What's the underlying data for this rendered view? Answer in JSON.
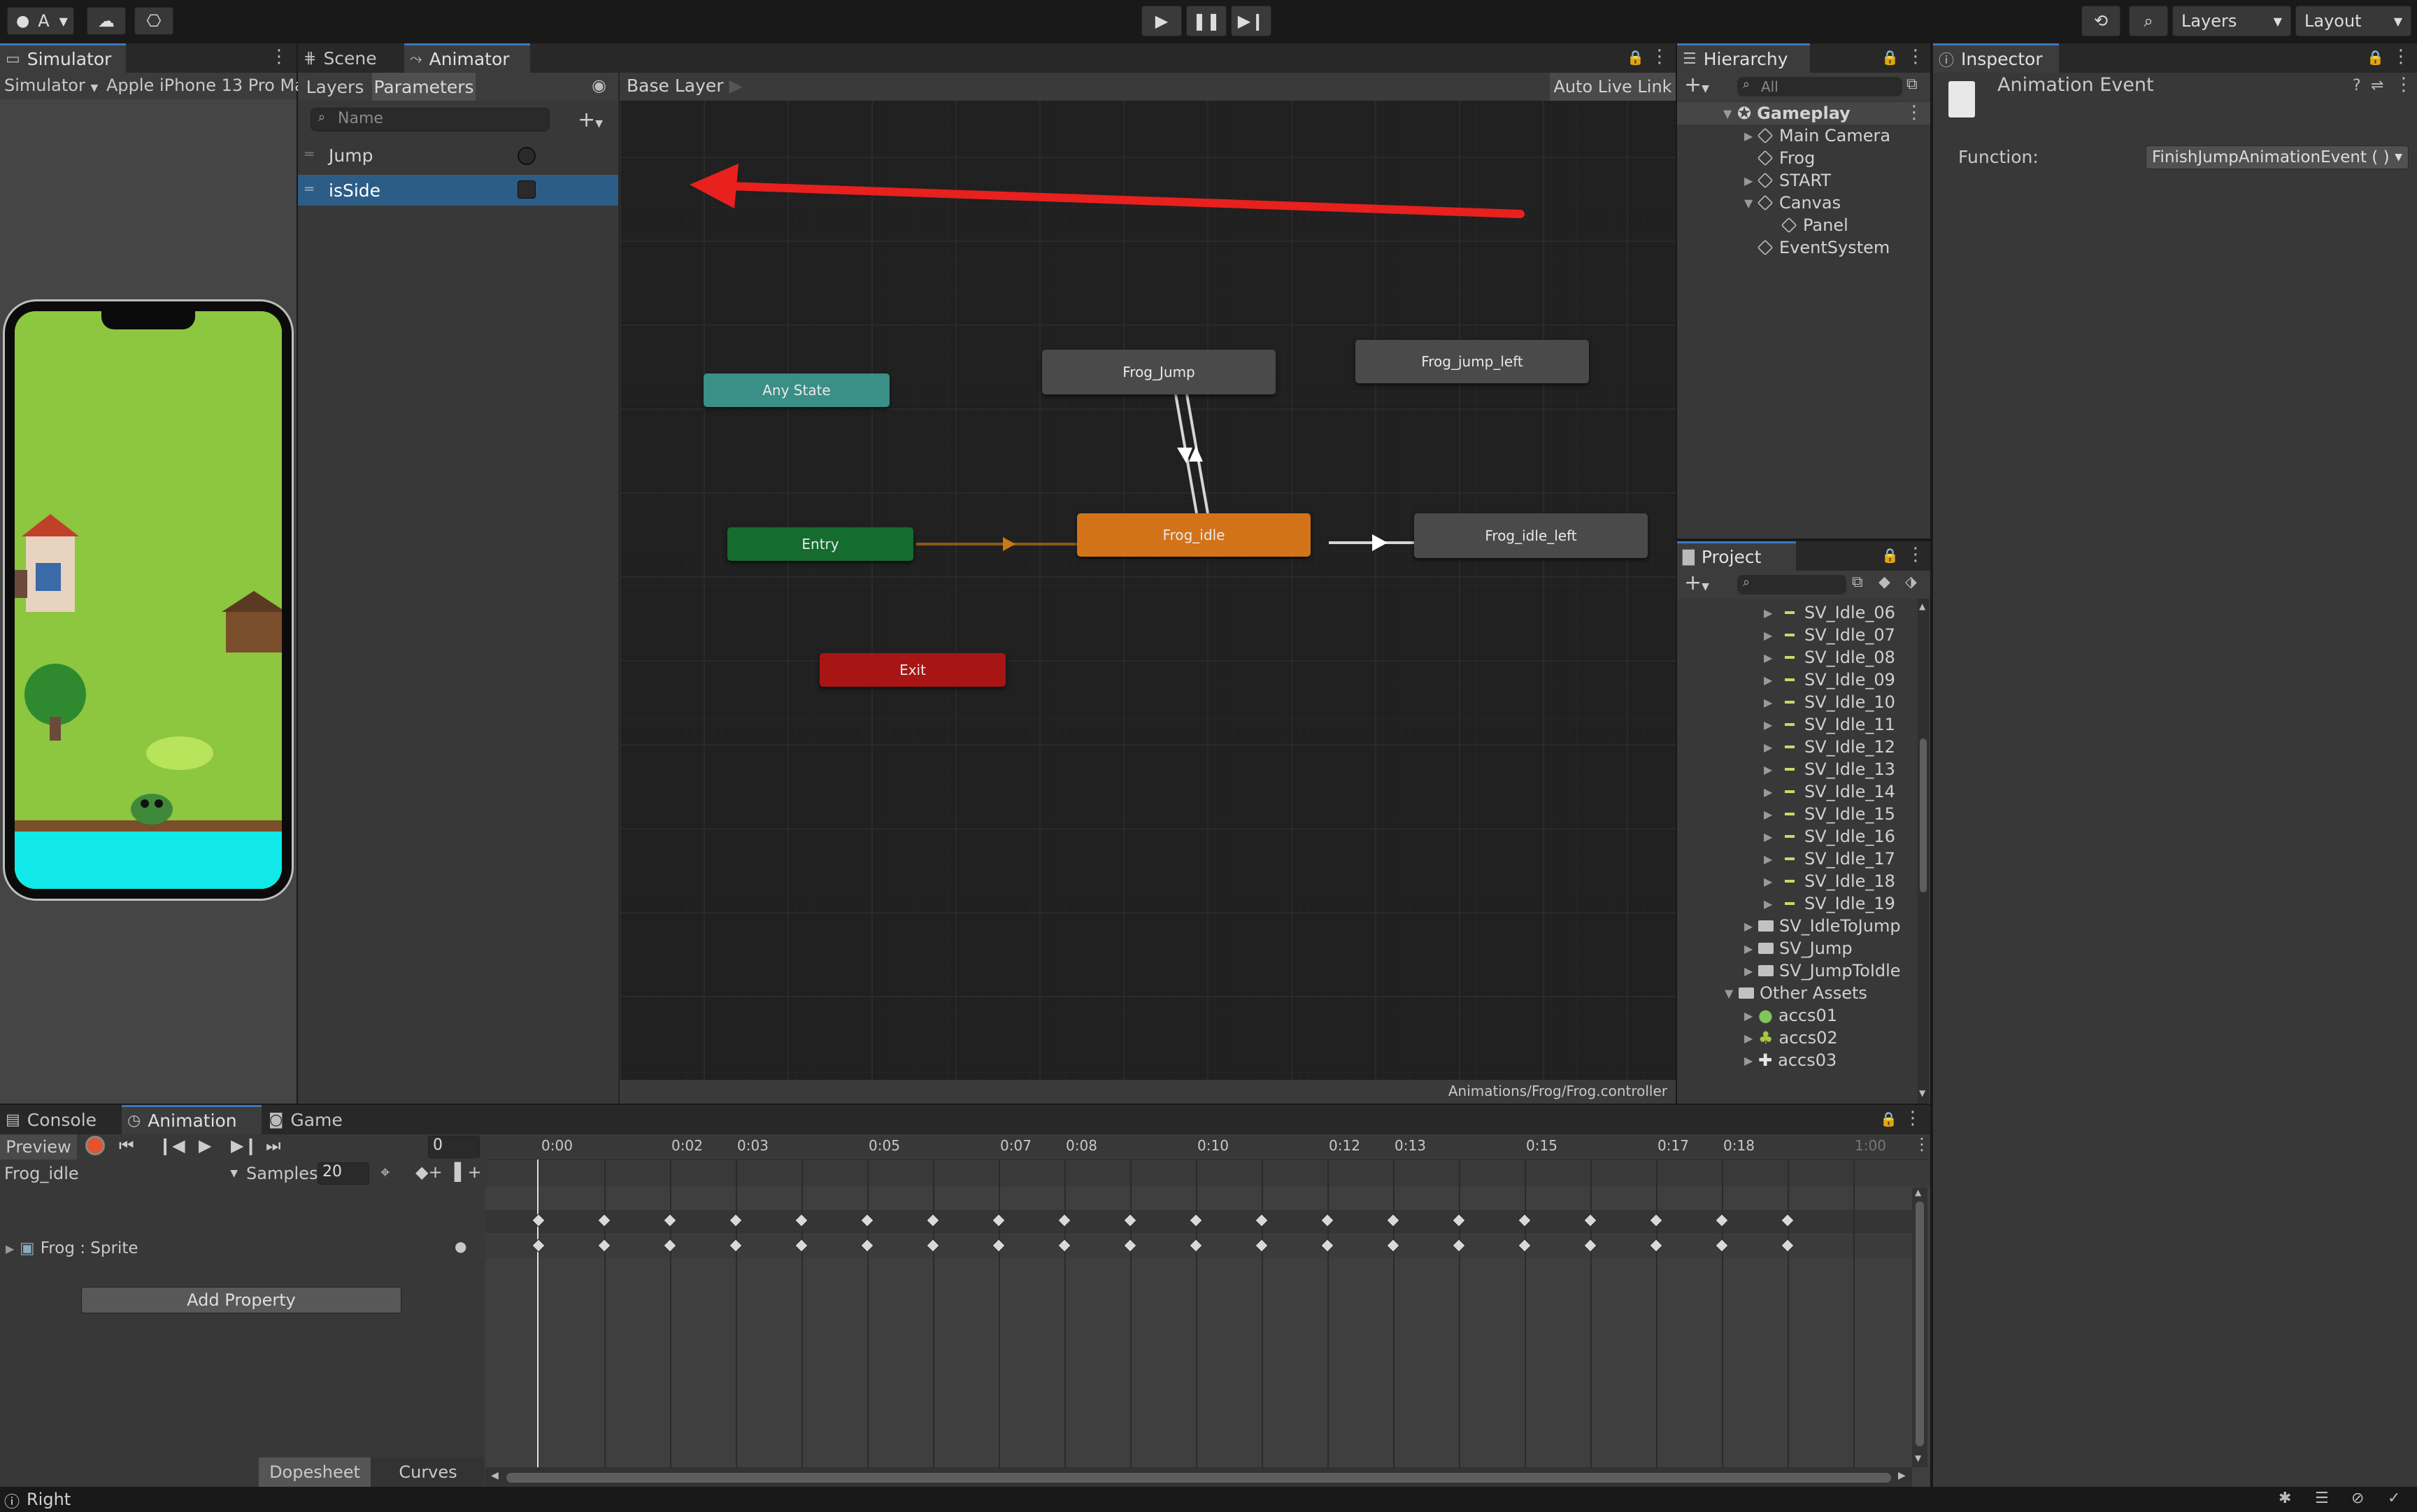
{
  "toolbar": {
    "account": "A",
    "layers": "Layers",
    "layout": "Layout"
  },
  "simulator": {
    "tab": "Simulator",
    "mode": "Simulator",
    "device": "Apple iPhone 13 Pro Ma"
  },
  "scene_tab": "Scene",
  "animator": {
    "tab": "Animator",
    "subtabs": [
      "Layers",
      "Parameters"
    ],
    "search_placeholder": "Name",
    "breadcrumb": "Base Layer",
    "auto_live_link": "Auto Live Link",
    "parameters": [
      {
        "name": "Jump",
        "type": "trigger"
      },
      {
        "name": "isSide",
        "type": "bool",
        "selected": true
      }
    ],
    "states": [
      "Any State",
      "Frog_Jump",
      "Frog_jump_left",
      "Entry",
      "Frog_idle",
      "Frog_idle_left",
      "Exit"
    ],
    "path": "Animations/Frog/Frog.controller",
    "colors": {
      "any_state": "#3a8f86",
      "entry": "#146c2f",
      "default": "#d2731a",
      "exit": "#a81515",
      "state": "#4a4a4a",
      "annotation_arrow": "#e8201e"
    }
  },
  "hierarchy": {
    "tab": "Hierarchy",
    "search_placeholder": "All",
    "scene": "Gameplay",
    "items": [
      {
        "label": "Main Camera",
        "expandable": true,
        "depth": 1
      },
      {
        "label": "Frog",
        "expandable": false,
        "depth": 1
      },
      {
        "label": "START",
        "expandable": true,
        "depth": 1
      },
      {
        "label": "Canvas",
        "expandable": true,
        "expanded": true,
        "depth": 1
      },
      {
        "label": "Panel",
        "expandable": false,
        "depth": 2
      },
      {
        "label": "EventSystem",
        "expandable": false,
        "depth": 1
      }
    ]
  },
  "project": {
    "tab": "Project",
    "items": [
      "SV_Idle_06",
      "SV_Idle_07",
      "SV_Idle_08",
      "SV_Idle_09",
      "SV_Idle_10",
      "SV_Idle_11",
      "SV_Idle_12",
      "SV_Idle_13",
      "SV_Idle_14",
      "SV_Idle_15",
      "SV_Idle_16",
      "SV_Idle_17",
      "SV_Idle_18",
      "SV_Idle_19"
    ],
    "folders": [
      "SV_IdleToJump",
      "SV_Jump",
      "SV_JumpToIdle"
    ],
    "other_assets": "Other Assets",
    "assets": [
      "accs01",
      "accs02",
      "accs03"
    ]
  },
  "inspector": {
    "tab": "Inspector",
    "title": "Animation Event",
    "function_label": "Function:",
    "function_value": "FinishJumpAnimationEvent ( )"
  },
  "bottom": {
    "tabs": [
      "Console",
      "Animation",
      "Game"
    ],
    "preview": "Preview",
    "frame": "0",
    "clip": "Frog_idle",
    "samples_label": "Samples",
    "samples": "20",
    "property": "Frog : Sprite",
    "add_property": "Add Property",
    "dopesheet": "Dopesheet",
    "curves": "Curves",
    "ticks": [
      "0:00",
      "0:02",
      "0:03",
      "0:05",
      "0:07",
      "0:08",
      "0:10",
      "0:12",
      "0:13",
      "0:15",
      "0:17",
      "0:18",
      "1:00"
    ]
  },
  "status": {
    "text": "Right"
  }
}
